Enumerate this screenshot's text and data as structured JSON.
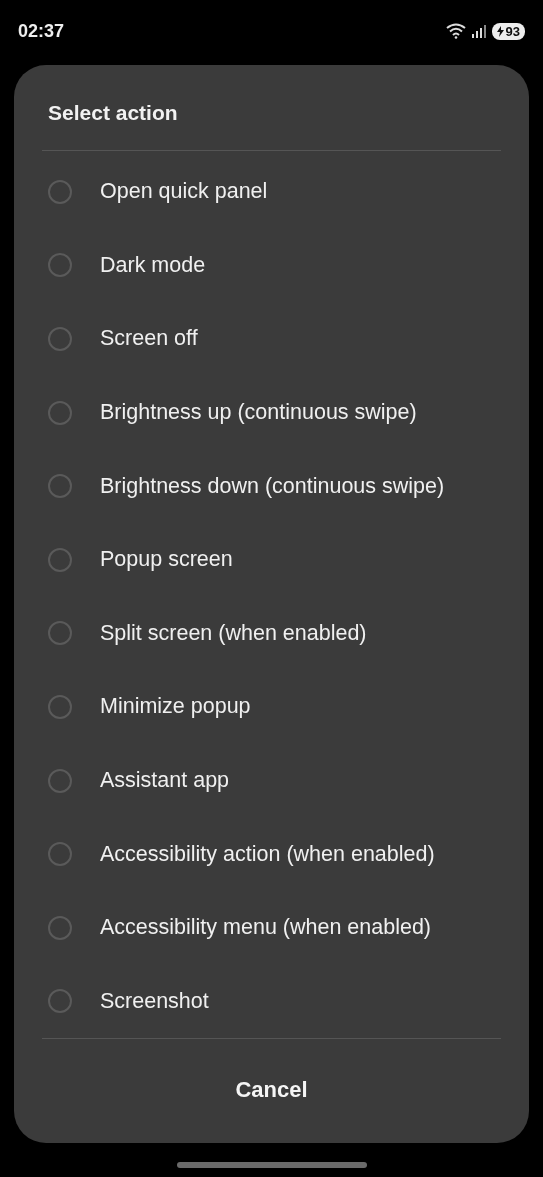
{
  "status_bar": {
    "time": "02:37",
    "battery": "93"
  },
  "dialog": {
    "title": "Select action",
    "options": [
      {
        "label": "Open quick panel",
        "selected": false
      },
      {
        "label": "Dark mode",
        "selected": false
      },
      {
        "label": "Screen off",
        "selected": false
      },
      {
        "label": "Brightness up (continuous swipe)",
        "selected": false
      },
      {
        "label": "Brightness down (continuous swipe)",
        "selected": false
      },
      {
        "label": "Popup screen",
        "selected": false
      },
      {
        "label": "Split screen (when enabled)",
        "selected": false
      },
      {
        "label": "Minimize popup",
        "selected": false
      },
      {
        "label": "Assistant app",
        "selected": false
      },
      {
        "label": "Accessibility action (when enabled)",
        "selected": false
      },
      {
        "label": "Accessibility menu (when enabled)",
        "selected": false
      },
      {
        "label": "Screenshot",
        "selected": false
      }
    ],
    "cancel": "Cancel"
  }
}
